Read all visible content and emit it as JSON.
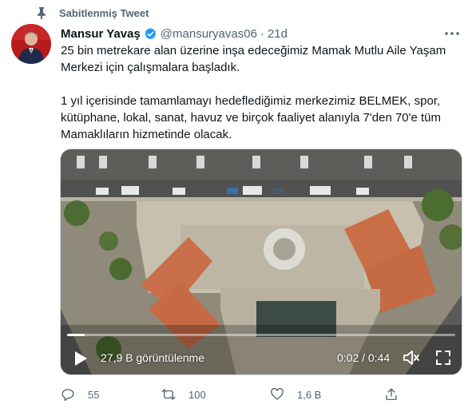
{
  "pinned": {
    "label": "Sabitlenmiş Tweet",
    "icon": "pin-icon"
  },
  "author": {
    "display_name": "Mansur Yavaş",
    "handle": "@mansuryavas06",
    "separator": "·",
    "time": "21d",
    "verified_icon": "verified-icon",
    "avatar_icon": "avatar"
  },
  "tweet": {
    "paragraph_1": "25 bin metrekare alan üzerine inşa edeceğimiz Mamak Mutlu Aile Yaşam Merkezi için çalışmalara başladık.",
    "paragraph_2": "1 yıl içerisinde tamamlamayı hedeflediğimiz merkezimiz BELMEK, spor, kütüphane, lokal, sanat, havuz ve birçok faaliyet alanıyla 7'den 70'e tüm Mamaklıların hizmetinde olacak."
  },
  "video": {
    "views": "27,9 B görüntülenme",
    "time": "0:02 / 0:44",
    "progress": 0.045,
    "icons": [
      "play-icon",
      "volume-icon",
      "fullscreen-icon"
    ]
  },
  "actions": {
    "reply_count": "55",
    "retweet_count": "100",
    "like_count": "1,6 B",
    "icons": [
      "reply-icon",
      "retweet-icon",
      "like-icon",
      "share-icon"
    ]
  },
  "colors": {
    "text_primary": "#0f1419",
    "text_secondary": "#536471",
    "verified_blue": "#1d9bf0"
  }
}
